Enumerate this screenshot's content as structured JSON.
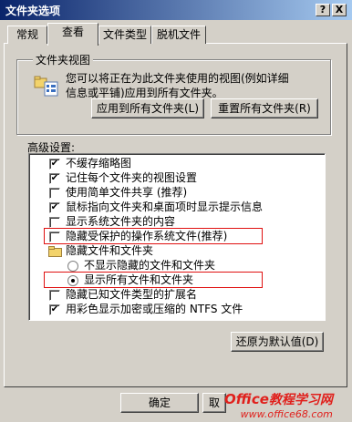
{
  "window": {
    "title": "文件夹选项",
    "help_glyph": "?",
    "close_glyph": "X"
  },
  "tabs": [
    {
      "label": "常规"
    },
    {
      "label": "查看",
      "active": true
    },
    {
      "label": "文件类型"
    },
    {
      "label": "脱机文件"
    }
  ],
  "folder_views": {
    "legend": "文件夹视图",
    "description_line1": "您可以将正在为此文件夹使用的视图(例如详细",
    "description_line2": "信息或平铺)应用到所有文件夹。",
    "apply_button": "应用到所有文件夹(L)",
    "reset_button": "重置所有文件夹(R)"
  },
  "advanced": {
    "label": "高级设置:",
    "items": [
      {
        "kind": "checkbox",
        "checked": true,
        "label": "不缓存缩略图"
      },
      {
        "kind": "checkbox",
        "checked": true,
        "label": "记住每个文件夹的视图设置"
      },
      {
        "kind": "checkbox",
        "checked": false,
        "label": "使用简单文件共享 (推荐)"
      },
      {
        "kind": "checkbox",
        "checked": true,
        "label": "鼠标指向文件夹和桌面项时显示提示信息"
      },
      {
        "kind": "checkbox",
        "checked": false,
        "label": "显示系统文件夹的内容"
      },
      {
        "kind": "checkbox",
        "checked": false,
        "label": "隐藏受保护的操作系统文件(推荐)"
      },
      {
        "kind": "folder",
        "label": "隐藏文件和文件夹"
      },
      {
        "kind": "radio",
        "checked": false,
        "label": "不显示隐藏的文件和文件夹"
      },
      {
        "kind": "radio",
        "checked": true,
        "label": "显示所有文件和文件夹"
      },
      {
        "kind": "checkbox",
        "checked": false,
        "label": "隐藏已知文件类型的扩展名"
      },
      {
        "kind": "checkbox",
        "checked": true,
        "label": "用彩色显示加密或压缩的 NTFS 文件"
      }
    ],
    "restore_button": "还原为默认值(D)"
  },
  "footer": {
    "ok_button": "确定",
    "second_button_partial": "取"
  },
  "watermark": {
    "brand_left": "Office",
    "brand_right": "教程学习网",
    "url": "www.office68.com"
  },
  "colors": {
    "title_start": "#0a246a",
    "title_end": "#a6caf0",
    "highlight": "#e01010",
    "watermark": "#e0201c"
  }
}
